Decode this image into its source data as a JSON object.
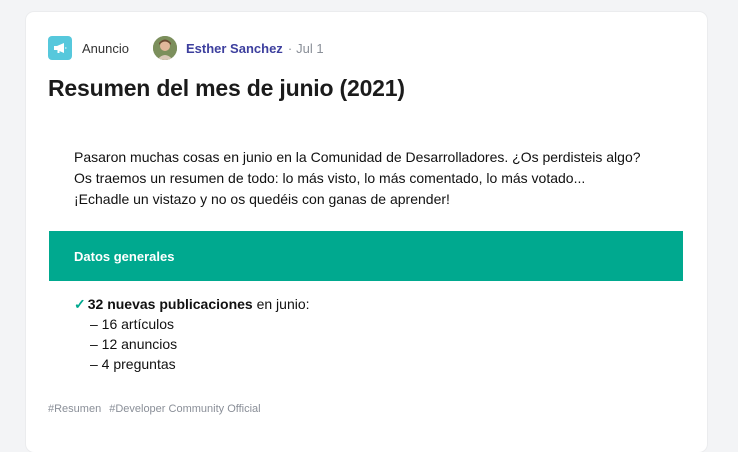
{
  "post": {
    "type_label": "Anuncio",
    "type_icon": "megaphone-icon",
    "author": "Esther Sanchez",
    "separator": "·",
    "date": "Jul 1",
    "title": "Resumen del mes de junio (2021)"
  },
  "intro_lines": [
    "Pasaron muchas cosas en junio en la Comunidad de Desarrolladores. ¿Os perdisteis algo?",
    "Os traemos un resumen de todo: lo más visto, lo más comentado, lo más votado...",
    "¡Echadle un vistazo y no os quedéis con ganas de aprender!"
  ],
  "section": {
    "title": "Datos generales"
  },
  "summary": {
    "check_icon": "✓",
    "highlight": "32 nuevas publicaciones",
    "rest": " en junio:",
    "items": [
      "– 16 artículos",
      "– 12 anuncios",
      "– 4 preguntas"
    ]
  },
  "tags": [
    "#Resumen",
    "#Developer Community Official"
  ],
  "colors": {
    "accent": "#00a98f",
    "type_icon_bg": "#56c8dc",
    "author": "#3d3f9e",
    "muted": "#8a8f98"
  }
}
